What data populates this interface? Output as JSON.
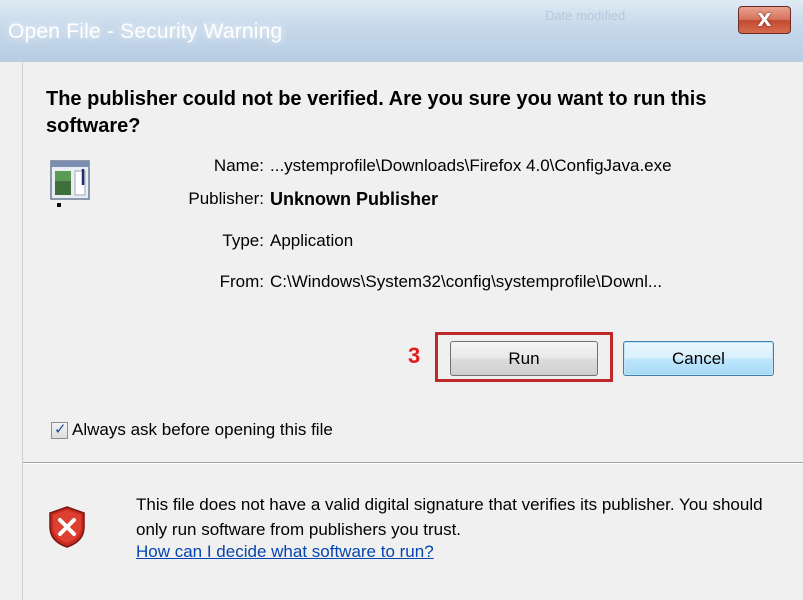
{
  "window": {
    "title": "Open File - Security Warning",
    "close_label": "X",
    "background_title": "Date modified"
  },
  "dialog": {
    "heading": "The publisher could not be verified.  Are you sure you want to run this software?",
    "icon": "program-window-icon",
    "fields": [
      {
        "label": "Name:",
        "value": "...ystemprofile\\Downloads\\Firefox 4.0\\ConfigJava.exe"
      },
      {
        "label": "Publisher:",
        "value": "Unknown Publisher"
      },
      {
        "label": "Type:",
        "value": "Application"
      },
      {
        "label": "From:",
        "value": "C:\\Windows\\System32\\config\\systemprofile\\Downl..."
      }
    ],
    "step_marker": "3",
    "run_label": "Run",
    "cancel_label": "Cancel",
    "checkbox": {
      "label": "Always ask before opening this file",
      "checked": true
    },
    "warning_icon": "shield-error-icon",
    "warning_text": "This file does not have a valid digital signature that verifies its publisher.  You should only run software from publishers you trust.",
    "help_link": "How can I decide what software to run?"
  },
  "colors": {
    "highlight": "#c0282a",
    "step_marker": "#e21b1b",
    "link": "#0645ad"
  }
}
